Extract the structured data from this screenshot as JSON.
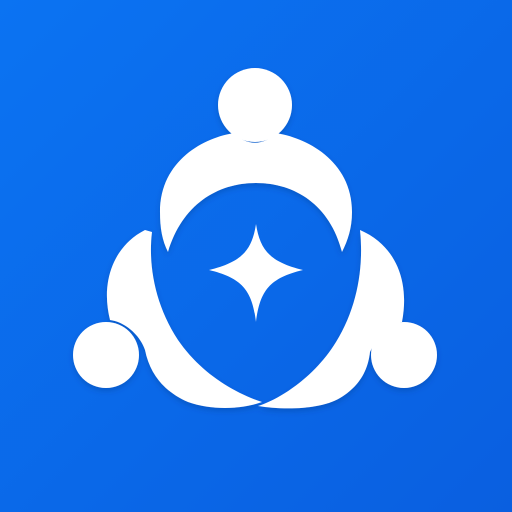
{
  "icon": {
    "name": "community-spark-app-icon",
    "symbol": "three-people-circle-with-sparkle",
    "colors": {
      "background_top": "#0a66e3",
      "background_bottom": "#0a5fe0",
      "background_left": "#0b73f2",
      "figure": "#ffffff",
      "spark": "#ffffff",
      "shadow": "#0a3c8c"
    }
  }
}
